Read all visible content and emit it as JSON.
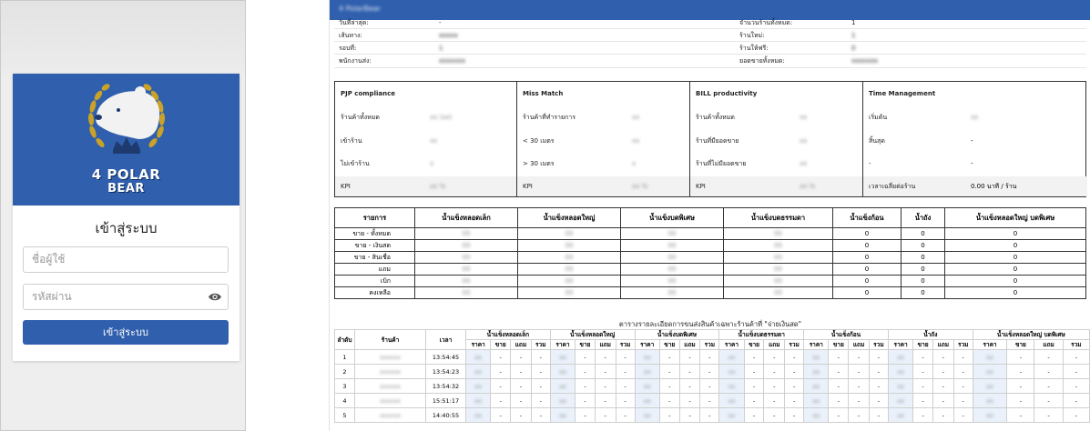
{
  "login": {
    "logo_line1": "4 POLAR",
    "logo_line2": "BEAR",
    "title": "เข้าสู่ระบบ",
    "username_placeholder": "ชื่อผู้ใช้",
    "password_placeholder": "รหัสผ่าน",
    "submit_label": "เข้าสู่ระบบ"
  },
  "report": {
    "header_title": "4 PolarBear",
    "info_left": [
      {
        "label": "วันที่ล่าสุด:",
        "value": "-"
      },
      {
        "label": "เส้นทาง:",
        "value": "xxxxx"
      },
      {
        "label": "รอบที่:",
        "value": "1"
      },
      {
        "label": "พนักงานส่ง:",
        "value": "xxxxxxx"
      }
    ],
    "info_right": [
      {
        "label": "จำนวนร้านทั้งหมด:",
        "value": "1"
      },
      {
        "label": "ร้านใหม่:",
        "value": "1"
      },
      {
        "label": "ร้านให้ฟรี:",
        "value": "0"
      },
      {
        "label": "ยอดขายทั้งหมด:",
        "value": "xxxxxxx"
      }
    ],
    "kpi": [
      {
        "title": "PJP compliance",
        "rows": [
          {
            "label": "ร้านค้าทั้งหมด",
            "value": "xx (xx)"
          },
          {
            "label": "เข้าร้าน",
            "value": "xx"
          },
          {
            "label": "ไม่เข้าร้าน",
            "value": "x"
          },
          {
            "label": "KPI",
            "value": "xx %"
          }
        ]
      },
      {
        "title": "Miss Match",
        "rows": [
          {
            "label": "ร้านค้าที่ทำรายการ",
            "value": "xx"
          },
          {
            "label": "< 30 เมตร",
            "value": "xx"
          },
          {
            "label": "> 30 เมตร",
            "value": "x"
          },
          {
            "label": "KPI",
            "value": "xx %"
          }
        ]
      },
      {
        "title": "BILL productivity",
        "rows": [
          {
            "label": "ร้านค้าทั้งหมด",
            "value": "xx"
          },
          {
            "label": "ร้านที่มียอดขาย",
            "value": "xx"
          },
          {
            "label": "ร้านที่ไม่มียอดขาย",
            "value": "xx"
          },
          {
            "label": "KPI",
            "value": "xx %"
          }
        ]
      },
      {
        "title": "Time Management",
        "rows": [
          {
            "label": "เริ่มต้น",
            "value": "xx"
          },
          {
            "label": "สิ้นสุด",
            "value": "-"
          },
          {
            "label": "-",
            "value": "-"
          },
          {
            "label": "เวลาเฉลี่ยต่อร้าน",
            "value": "0.00 นาที / ร้าน"
          }
        ]
      }
    ],
    "sales_headers": [
      "รายการ",
      "น้ำแข็งหลอดเล็ก",
      "น้ำแข็งหลอดใหญ่",
      "น้ำแข็งบดพิเศษ",
      "น้ำแข็งบดธรรมดา",
      "น้ำแข็งก้อน",
      "น้ำถัง",
      "น้ำแข็งหลอดใหญ่ บดพิเศษ"
    ],
    "sales_rows": [
      {
        "label": "ขาย - ทั้งหมด",
        "c5": "0",
        "c6": "0",
        "c7": "0"
      },
      {
        "label": "ขาย - เงินสด",
        "c5": "0",
        "c6": "0",
        "c7": "0"
      },
      {
        "label": "ขาย - สินเชื่อ",
        "c5": "0",
        "c6": "0",
        "c7": "0"
      },
      {
        "label": "แถม",
        "c5": "0",
        "c6": "0",
        "c7": "0"
      },
      {
        "label": "เบิก",
        "c5": "0",
        "c6": "0",
        "c7": "0"
      },
      {
        "label": "คงเหลือ",
        "c5": "0",
        "c6": "0",
        "c7": "0"
      }
    ],
    "detail_title": "ตารางรายละเอียดการขนส่งสินค้าเฉพาะร้านค้าที่ \"จ่ายเงินสด\"",
    "detail_head_fixed": [
      "ลำดับ",
      "ร้านค้า",
      "เวลา"
    ],
    "detail_groups": [
      "น้ำแข็งหลอดเล็ก",
      "น้ำแข็งหลอดใหญ่",
      "น้ำแข็งบดพิเศษ",
      "น้ำแข็งบดธรรมดา",
      "น้ำแข็งก้อน",
      "น้ำถัง",
      "น้ำแข็งหลอดใหญ่ บดพิเศษ"
    ],
    "detail_sub": [
      "ราคา",
      "ขาย",
      "แถม",
      "รวม"
    ],
    "detail_rows": [
      {
        "no": "1",
        "time": "13:54:45"
      },
      {
        "no": "2",
        "time": "13:54:23"
      },
      {
        "no": "3",
        "time": "13:54:32"
      },
      {
        "no": "4",
        "time": "15:51:17"
      },
      {
        "no": "5",
        "time": "14:40:55"
      }
    ],
    "dash": "-"
  }
}
